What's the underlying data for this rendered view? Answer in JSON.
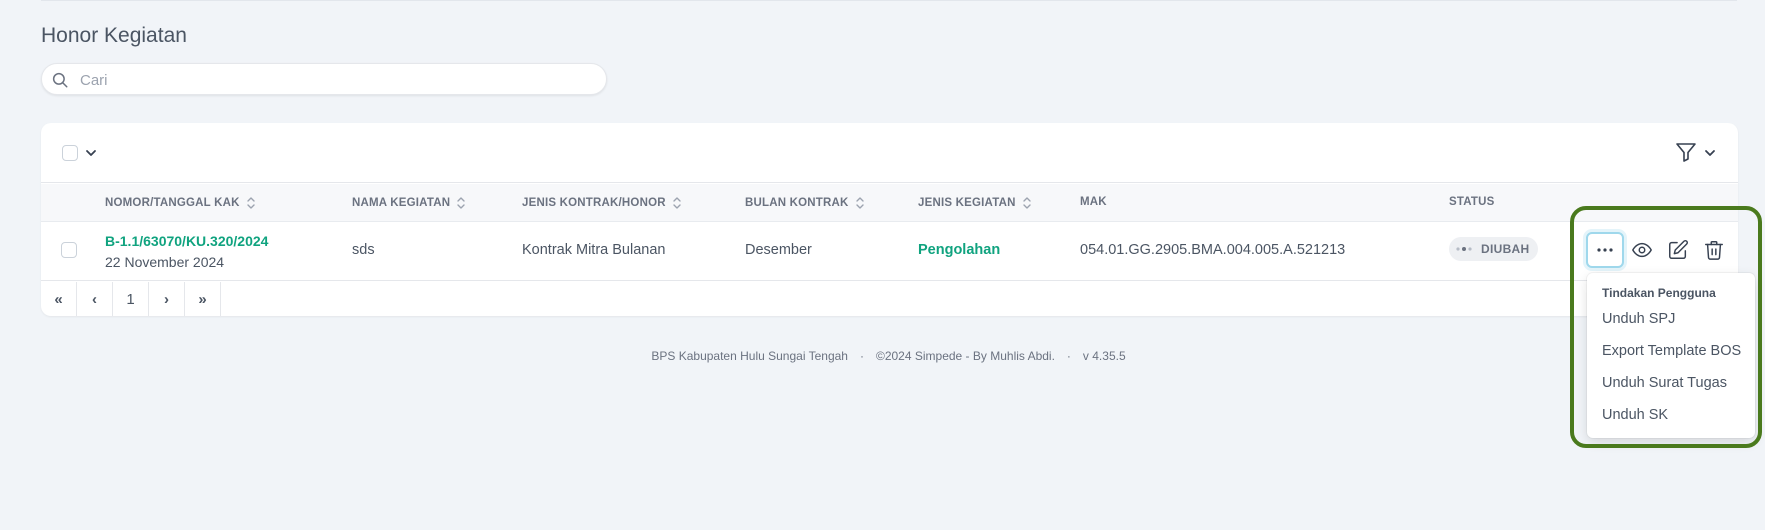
{
  "page": {
    "title": "Honor Kegiatan"
  },
  "search": {
    "placeholder": "Cari",
    "value": ""
  },
  "table": {
    "columns": [
      "NOMOR/TANGGAL KAK",
      "NAMA KEGIATAN",
      "JENIS KONTRAK/HONOR",
      "BULAN KONTRAK",
      "JENIS KEGIATAN",
      "MAK",
      "STATUS"
    ],
    "rows": [
      {
        "kak_number": "B-1.1/63070/KU.320/2024",
        "kak_date": "22 November 2024",
        "nama_kegiatan": "sds",
        "jenis_kontrak": "Kontrak Mitra Bulanan",
        "bulan_kontrak": "Desember",
        "jenis_kegiatan": "Pengolahan",
        "mak": "054.01.GG.2905.BMA.004.005.A.521213",
        "status": "DIUBAH"
      }
    ]
  },
  "pagination": {
    "first": "«",
    "prev": "‹",
    "current": "1",
    "next": "›",
    "last": "»"
  },
  "dropdown": {
    "header": "Tindakan Pengguna",
    "items": [
      "Unduh SPJ",
      "Export Template BOS",
      "Unduh Surat Tugas",
      "Unduh SK"
    ]
  },
  "footer": {
    "org": "BPS Kabupaten Hulu Sungai Tengah",
    "separator": "·",
    "copyright": "©2024 Simpede - By Muhlis Abdi.",
    "version": "v 4.35.5"
  },
  "icons": {
    "search": "search-icon",
    "filter": "filter-icon",
    "more": "more-horizontal-icon",
    "view": "eye-icon",
    "edit": "edit-icon",
    "delete": "trash-icon"
  },
  "colors": {
    "accent": "#10a37f",
    "highlight": "#4a7a1d",
    "background": "#f1f4f8"
  }
}
